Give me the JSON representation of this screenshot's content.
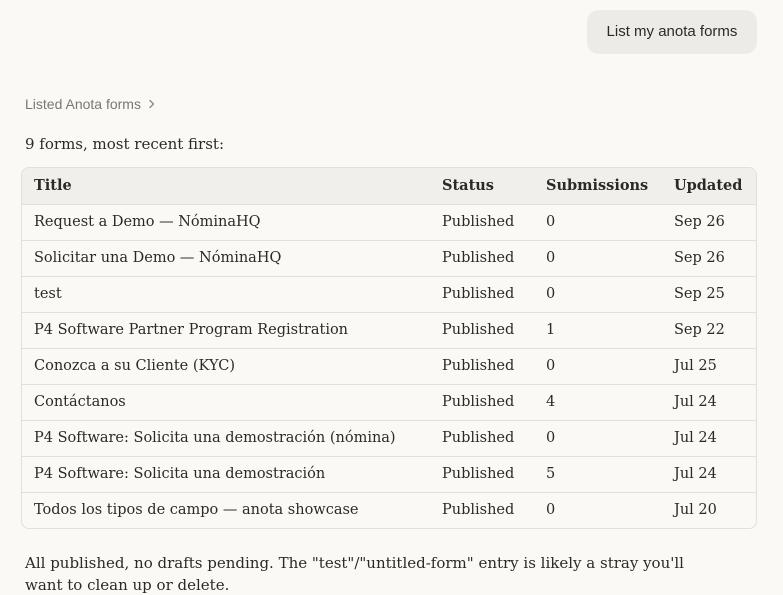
{
  "user_message": "List my anota forms",
  "tool_summary": {
    "label": "Listed Anota forms",
    "icon": "chevron-right-icon"
  },
  "intro": "9 forms, most recent first:",
  "table": {
    "headers": {
      "title": "Title",
      "status": "Status",
      "submissions": "Submissions",
      "updated": "Updated"
    },
    "rows": [
      {
        "title": "Request a Demo — NóminaHQ",
        "status": "Published",
        "submissions": "0",
        "updated": "Sep 26"
      },
      {
        "title": "Solicitar una Demo — NóminaHQ",
        "status": "Published",
        "submissions": "0",
        "updated": "Sep 26"
      },
      {
        "title": "test",
        "status": "Published",
        "submissions": "0",
        "updated": "Sep 25"
      },
      {
        "title": "P4 Software Partner Program Registration",
        "status": "Published",
        "submissions": "1",
        "updated": "Sep 22"
      },
      {
        "title": "Conozca a su Cliente (KYC)",
        "status": "Published",
        "submissions": "0",
        "updated": "Jul 25"
      },
      {
        "title": "Contáctanos",
        "status": "Published",
        "submissions": "4",
        "updated": "Jul 24"
      },
      {
        "title": "P4 Software: Solicita una demostración (nómina)",
        "status": "Published",
        "submissions": "0",
        "updated": "Jul 24"
      },
      {
        "title": "P4 Software: Solicita una demostración",
        "status": "Published",
        "submissions": "5",
        "updated": "Jul 24"
      },
      {
        "title": "Todos los tipos de campo — anota showcase",
        "status": "Published",
        "submissions": "0",
        "updated": "Jul 20"
      }
    ]
  },
  "footer": "All published, no drafts pending. The \"test\"/\"untitled-form\" entry is likely a stray you'll want to clean up or delete."
}
